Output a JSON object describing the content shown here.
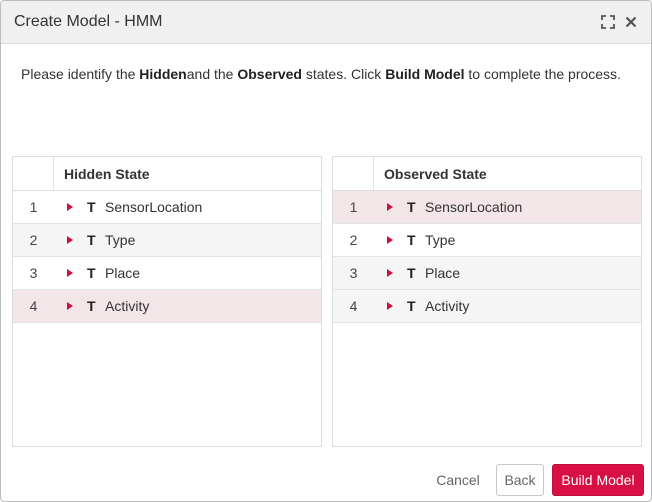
{
  "window": {
    "title": "Create Model - HMM",
    "icons": {
      "maximize": "maximize-icon",
      "close": "close-icon"
    }
  },
  "instruction": {
    "p1": "Please identify the ",
    "b1": "Hidden",
    "p2": "and the ",
    "b2": "Observed",
    "p3": " states. Click ",
    "b3": "Build Model",
    "p4": " to complete the process."
  },
  "hidden_state": {
    "header": "Hidden State",
    "rows": [
      {
        "num": "1",
        "type": "T",
        "label": "SensorLocation",
        "selected": false
      },
      {
        "num": "2",
        "type": "T",
        "label": "Type",
        "selected": false
      },
      {
        "num": "3",
        "type": "T",
        "label": "Place",
        "selected": false
      },
      {
        "num": "4",
        "type": "T",
        "label": "Activity",
        "selected": true
      }
    ]
  },
  "observed_state": {
    "header": "Observed State",
    "rows": [
      {
        "num": "1",
        "type": "T",
        "label": "SensorLocation",
        "selected": true
      },
      {
        "num": "2",
        "type": "T",
        "label": "Type",
        "selected": false
      },
      {
        "num": "3",
        "type": "T",
        "label": "Place",
        "selected": false
      },
      {
        "num": "4",
        "type": "T",
        "label": "Activity",
        "selected": false
      }
    ]
  },
  "footer": {
    "cancel": "Cancel",
    "back": "Back",
    "build": "Build Model"
  },
  "colors": {
    "accent": "#d80f44",
    "selected_row": "#f3e6e8",
    "caret": "#d0103a"
  }
}
